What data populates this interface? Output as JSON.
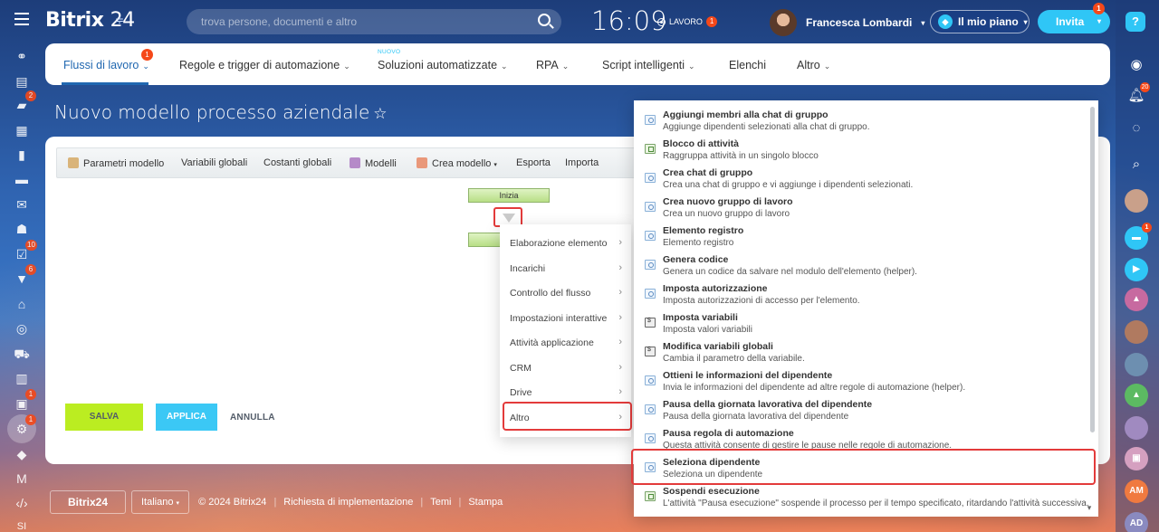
{
  "header": {
    "logo_brand": "Bitrix",
    "logo_num": "24",
    "search_placeholder": "trova persone, documenti e altro",
    "clock": "16:09",
    "work_status": "LAVORO",
    "work_badge": "1",
    "user_name": "Francesca Lombardi",
    "plan_label": "Il mio piano",
    "invite_label": "Invita",
    "invite_badge": "1"
  },
  "left_sidebar": {
    "badges": [
      "2",
      "10",
      "6",
      "1",
      "1"
    ]
  },
  "nav": {
    "items": [
      {
        "label": "Flussi di lavoro",
        "badge": "1"
      },
      {
        "label": "Regole e trigger di automazione"
      },
      {
        "label": "Soluzioni automatizzate",
        "tag": "NUOVO"
      },
      {
        "label": "RPA"
      },
      {
        "label": "Script intelligenti"
      },
      {
        "label": "Elenchi"
      },
      {
        "label": "Altro"
      }
    ]
  },
  "page_title": "Nuovo modello processo aziendale",
  "toolbar": {
    "params": "Parametri modello",
    "global_vars": "Variabili globali",
    "global_consts": "Costanti globali",
    "models": "Modelli",
    "create_model": "Crea modello",
    "export": "Esporta",
    "import": "Importa"
  },
  "canvas": {
    "start_label": "Inizia"
  },
  "actions": {
    "save": "SALVA",
    "apply": "APPLICA",
    "cancel": "ANNULLA"
  },
  "category_menu": [
    "Elaborazione elemento",
    "Incarichi",
    "Controllo del flusso",
    "Impostazioni interattive",
    "Attività applicazione",
    "CRM",
    "Drive",
    "Altro"
  ],
  "activities": [
    {
      "title": "Aggiungi membri alla chat di gruppo",
      "desc": "Aggiunge dipendenti selezionati alla chat di gruppo."
    },
    {
      "title": "Blocco di attività",
      "desc": "Raggruppa attività in un singolo blocco"
    },
    {
      "title": "Crea chat di gruppo",
      "desc": "Crea una chat di gruppo e vi aggiunge i dipendenti selezionati."
    },
    {
      "title": "Crea nuovo gruppo di lavoro",
      "desc": "Crea un nuovo gruppo di lavoro"
    },
    {
      "title": "Elemento registro",
      "desc": "Elemento registro"
    },
    {
      "title": "Genera codice",
      "desc": "Genera un codice da salvare nel modulo dell'elemento (helper)."
    },
    {
      "title": "Imposta autorizzazione",
      "desc": "Imposta autorizzazioni di accesso per l'elemento."
    },
    {
      "title": "Imposta variabili",
      "desc": "Imposta valori variabili"
    },
    {
      "title": "Modifica variabili globali",
      "desc": "Cambia il parametro della variabile."
    },
    {
      "title": "Ottieni le informazioni del dipendente",
      "desc": "Invia le informazioni del dipendente ad altre regole di automazione (helper)."
    },
    {
      "title": "Pausa della giornata lavorativa del dipendente",
      "desc": "Pausa della giornata lavorativa del dipendente"
    },
    {
      "title": "Pausa regola di automazione",
      "desc": "Questa attività consente di gestire le pause nelle regole di automazione."
    },
    {
      "title": "Seleziona dipendente",
      "desc": "Seleziona un dipendente"
    },
    {
      "title": "Sospendi esecuzione",
      "desc": "L'attività \"Pausa esecuzione\" sospende il processo per il tempo specificato, ritardando l'attività successiva."
    }
  ],
  "right_sidebar": {
    "notif_badge": "20",
    "chat_badge": "1",
    "initials_1": "AM",
    "initials_2": "AD"
  },
  "footer": {
    "logo": "Bitrix24",
    "language": "Italiano",
    "copyright": "© 2024 Bitrix24",
    "links": [
      "Richiesta di implementazione",
      "Temi",
      "Stampa"
    ]
  },
  "colors": {
    "accent": "#2067b0",
    "save": "#bbed21",
    "apply": "#3bc8f5",
    "highlight": "#e33b3b",
    "badge": "#f54819"
  }
}
